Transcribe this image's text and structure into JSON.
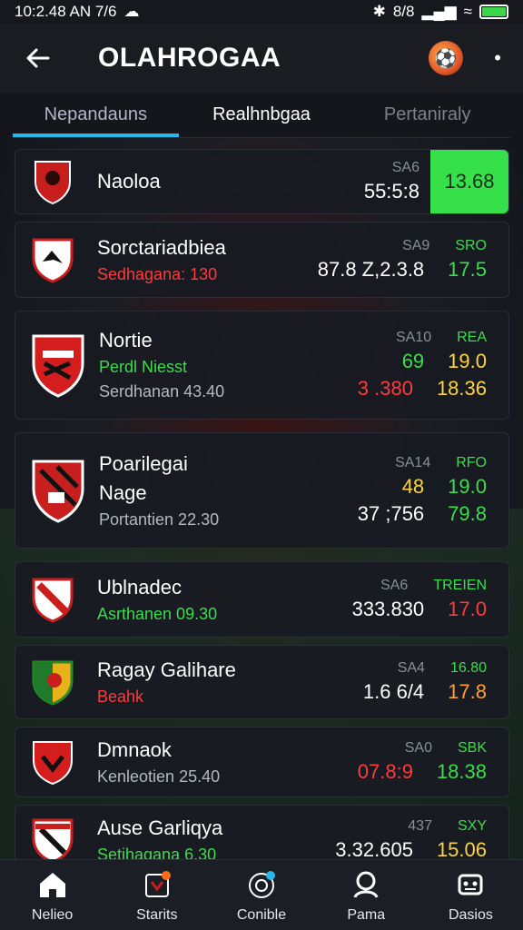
{
  "status_bar": {
    "time": "10:2.48 AN 7/6",
    "signal_text": "8/8"
  },
  "header": {
    "title": "OLAHROGAA"
  },
  "tabs": [
    {
      "label": "Nepandauns"
    },
    {
      "label": "Realhnbgaa"
    },
    {
      "label": "Pertaniraly"
    }
  ],
  "rows": [
    {
      "name": "Naoloa",
      "sub": "",
      "head": [
        "SA6"
      ],
      "vals": [
        "55:5:8"
      ],
      "highlight": "13.68"
    },
    {
      "name": "Sorctariadbiea",
      "sub": "Sedhagana: 130",
      "head": [
        "SA9",
        "SRO"
      ],
      "vals": [
        "87.8 Z,2.3.8",
        "17.5"
      ]
    },
    {
      "name": "Nortie",
      "sub": "Perdl Niesst",
      "sub2": "Serdhanan 43.40",
      "head": [
        "SA10",
        "REA"
      ],
      "vals": [
        "69",
        "19.0"
      ],
      "vals2": [
        "3 .380",
        "18.36"
      ]
    },
    {
      "name": "Poarilegai",
      "sub": "Nage",
      "sub2": "Portantien 22.30",
      "head": [
        "SA14",
        "RFO"
      ],
      "vals": [
        "48",
        "19.0"
      ],
      "vals2": [
        "37 ;756",
        "79.8"
      ]
    },
    {
      "name": "Ublnadec",
      "sub": "Asrthanen 09.30",
      "head": [
        "SA6",
        "TREIEN"
      ],
      "vals": [
        "333.830",
        "17.0"
      ]
    },
    {
      "name": "Ragay Galihare",
      "sub": "Beahk",
      "head": [
        "SA4",
        "16.80"
      ],
      "vals": [
        "1.6 6/4",
        "17.8"
      ]
    },
    {
      "name": "Dmnaok",
      "sub": "Kenleotien 25.40",
      "head": [
        "SA0",
        "SBK"
      ],
      "vals": [
        "07.8:9",
        "18.38"
      ]
    },
    {
      "name": "Ause Garliqya",
      "sub": "Setihagana 6.30",
      "head": [
        "437",
        "SXY"
      ],
      "vals": [
        "3.32.605",
        "15.06"
      ]
    }
  ],
  "bottom_nav": [
    {
      "label": "Nelieo",
      "icon": "home-icon"
    },
    {
      "label": "Starits",
      "icon": "shield-badge-icon"
    },
    {
      "label": "Conible",
      "icon": "ball-icon"
    },
    {
      "label": "Pama",
      "icon": "profile-icon"
    },
    {
      "label": "Dasios",
      "icon": "robot-icon"
    }
  ],
  "colors": {
    "accent": "#27b7e8",
    "highlight": "#36e04a",
    "red": "#ff3b3b",
    "green": "#3ddc4c",
    "yellow": "#ffd43a"
  }
}
